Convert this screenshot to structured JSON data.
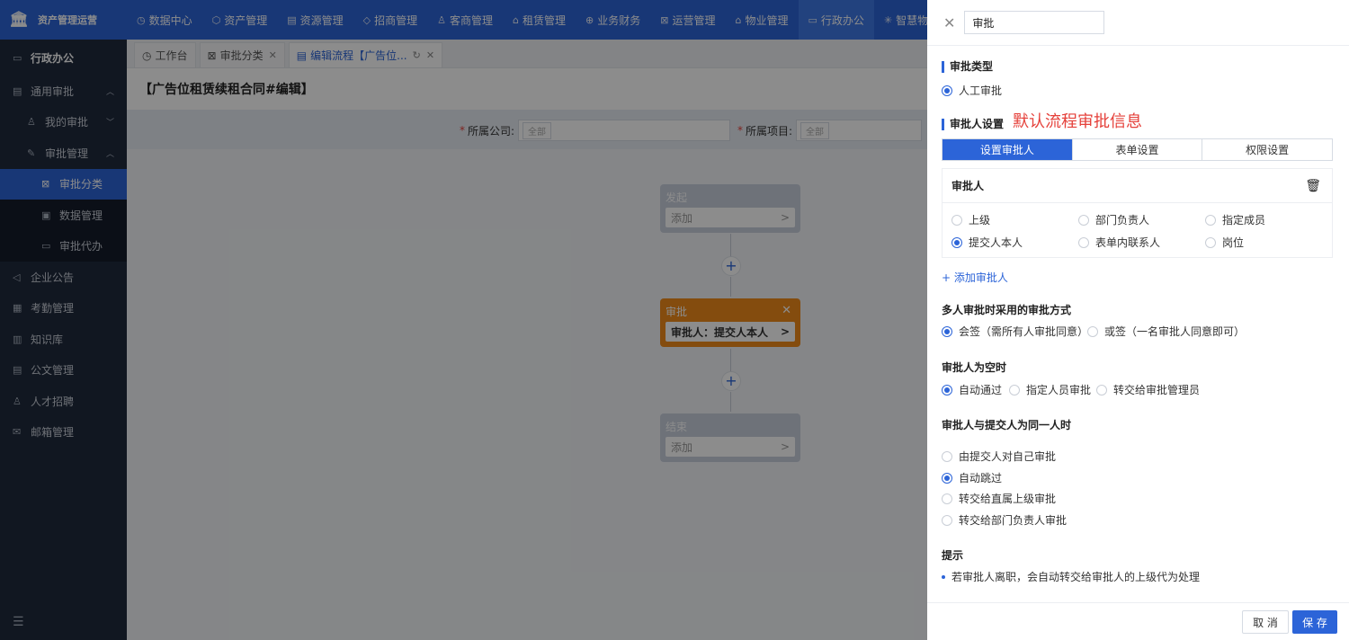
{
  "app": {
    "logo_text": "资产管理运营"
  },
  "topnav": [
    {
      "icon": "◷",
      "label": "数据中心",
      "active": false
    },
    {
      "icon": "⬡",
      "label": "资产管理",
      "active": false
    },
    {
      "icon": "▤",
      "label": "资源管理",
      "active": false
    },
    {
      "icon": "◇",
      "label": "招商管理",
      "active": false
    },
    {
      "icon": "♙",
      "label": "客商管理",
      "active": false
    },
    {
      "icon": "⌂",
      "label": "租赁管理",
      "active": false
    },
    {
      "icon": "⊕",
      "label": "业务财务",
      "active": false
    },
    {
      "icon": "⊠",
      "label": "运营管理",
      "active": false
    },
    {
      "icon": "⌂",
      "label": "物业管理",
      "active": false
    },
    {
      "icon": "▭",
      "label": "行政办公",
      "active": true
    },
    {
      "icon": "✳",
      "label": "智慧物联",
      "active": false
    }
  ],
  "sidebar": {
    "section": "行政办公",
    "items": [
      {
        "label": "通用审批",
        "level": 0,
        "arrow": "︿"
      },
      {
        "label": "我的审批",
        "level": 1,
        "arrow": "﹀"
      },
      {
        "label": "审批管理",
        "level": 1,
        "arrow": "︿"
      },
      {
        "label": "审批分类",
        "level": 2,
        "active": true
      },
      {
        "label": "数据管理",
        "level": 2
      },
      {
        "label": "审批代办",
        "level": 2
      },
      {
        "label": "企业公告",
        "level": 0
      },
      {
        "label": "考勤管理",
        "level": 0
      },
      {
        "label": "知识库",
        "level": 0
      },
      {
        "label": "公文管理",
        "level": 0
      },
      {
        "label": "人才招聘",
        "level": 0
      },
      {
        "label": "邮箱管理",
        "level": 0
      }
    ]
  },
  "tabs": [
    {
      "label": "工作台",
      "icon": "◷"
    },
    {
      "label": "审批分类",
      "icon": "⊠",
      "closable": true
    },
    {
      "label": "编辑流程【广告位...",
      "icon": "▤",
      "closable": true,
      "active": true
    }
  ],
  "page": {
    "title": "【广告位租赁续租合同#编辑】",
    "filters": [
      {
        "label": "所属公司:",
        "value": "全部"
      },
      {
        "label": "所属项目:",
        "value": "全部"
      }
    ]
  },
  "flow": {
    "start": {
      "title": "发起",
      "body": "添加"
    },
    "approve": {
      "title": "审批",
      "body": "审批人：提交人本人"
    },
    "end": {
      "title": "结束",
      "body": "添加"
    },
    "plus": "+",
    "chevron": ">",
    "close": "✕"
  },
  "drawer": {
    "title_value": "审批",
    "approval_type": {
      "title": "审批类型",
      "option": "人工审批"
    },
    "approver_settings": {
      "title": "审批人设置",
      "note": "默认流程审批信息"
    },
    "seg_tabs": [
      "设置审批人",
      "表单设置",
      "权限设置"
    ],
    "card": {
      "title": "审批人",
      "options": [
        "上级",
        "部门负责人",
        "指定成员",
        "提交人本人",
        "表单内联系人",
        "岗位"
      ],
      "selected": "提交人本人"
    },
    "add_approver": "+ 添加审批人",
    "multi": {
      "title": "多人审批时采用的审批方式",
      "options": [
        "会签（需所有人审批同意）",
        "或签（一名审批人同意即可）"
      ],
      "selected": 0
    },
    "empty": {
      "title": "审批人为空时",
      "options": [
        "自动通过",
        "指定人员审批",
        "转交给审批管理员"
      ],
      "selected": 0
    },
    "same": {
      "title": "审批人与提交人为同一人时",
      "options": [
        "由提交人对自己审批",
        "自动跳过",
        "转交给直属上级审批",
        "转交给部门负责人审批"
      ],
      "selected": 1
    },
    "tip": {
      "title": "提示",
      "text": "若审批人离职，会自动转交给审批人的上级代为处理"
    },
    "buttons": {
      "cancel": "取 消",
      "save": "保 存"
    }
  },
  "colors": {
    "primary": "#2c64d8",
    "orange_node": "#f08a1a",
    "note_red": "#e5403a",
    "sidebar_bg": "#1f2a3d"
  }
}
